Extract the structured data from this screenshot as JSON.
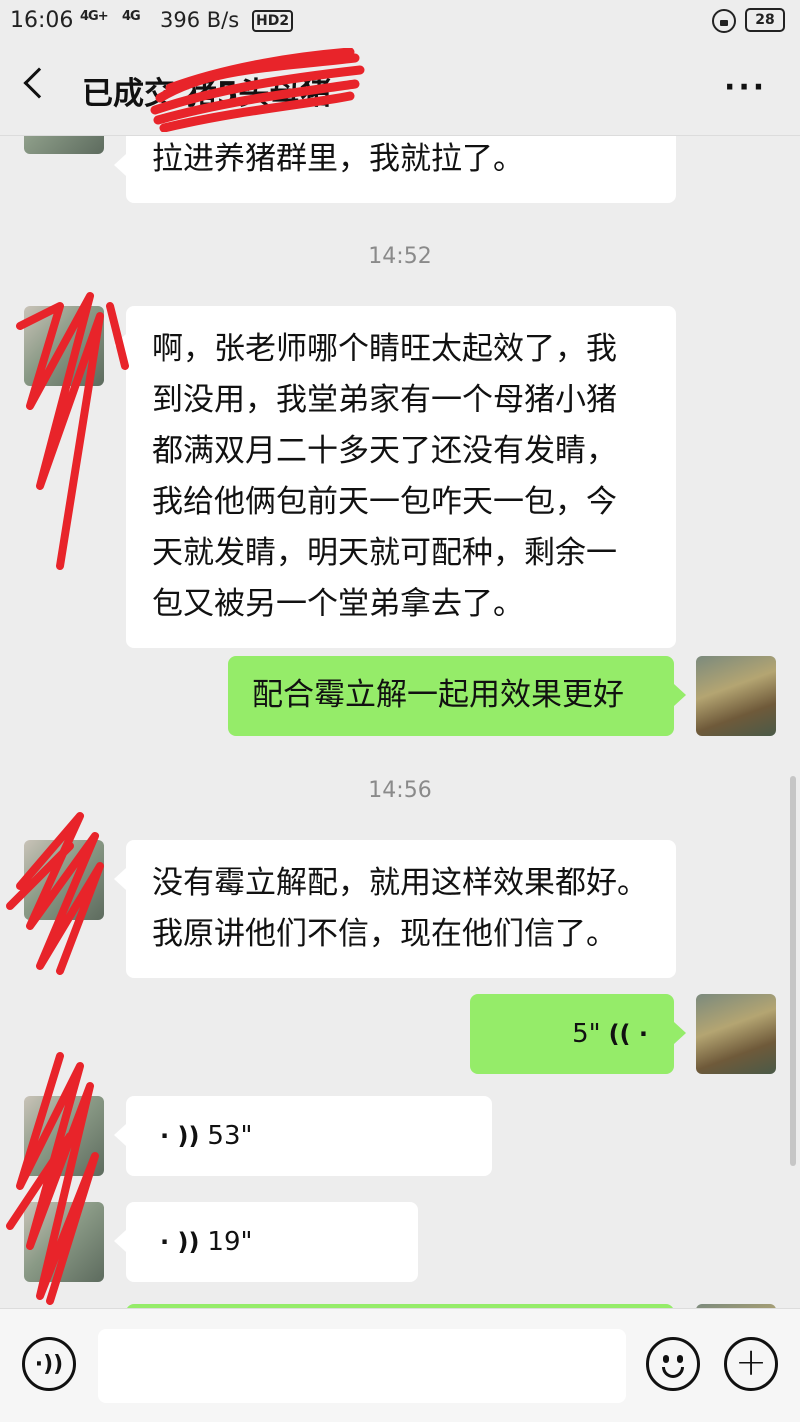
{
  "status_bar": {
    "time": "16:06",
    "signal1": "4G+",
    "signal2": "4G",
    "net_speed": "396 B/s",
    "hd": "HD2",
    "battery": "28"
  },
  "header": {
    "title": "已成交          猪5头母猪",
    "more": "···"
  },
  "messages": [
    {
      "side": "left",
      "text": "拉进养猪群里，我就拉了。"
    },
    {
      "type": "time",
      "text": "14:52"
    },
    {
      "side": "left",
      "lines": [
        "啊，张老师哪个睛旺太起效了，我",
        "到没用，我堂弟家有一个母猪小猪",
        "都满双月二十多天了还没有发睛，",
        "我给他俩包前天一包咋天一包，今",
        "天就发睛，明天就可配种，剩余一",
        "包又被另一个堂弟拿去了。"
      ]
    },
    {
      "side": "right",
      "text": "配合霉立解一起用效果更好"
    },
    {
      "type": "time",
      "text": "14:56"
    },
    {
      "side": "left",
      "lines": [
        "没有霉立解配，就用这样效果都好。",
        "我原讲他们不信，现在他们信了。"
      ]
    },
    {
      "side": "right",
      "type": "voice",
      "duration": "5\""
    },
    {
      "side": "left",
      "type": "voice",
      "duration": "53\""
    },
    {
      "side": "left",
      "type": "voice",
      "duration": "19\""
    }
  ],
  "input_bar": {
    "placeholder": ""
  },
  "colors": {
    "background": "#ededed",
    "sent_bubble": "#95ec69",
    "received_bubble": "#ffffff",
    "redaction": "#e8242a"
  },
  "icons": [
    "back-arrow-icon",
    "more-icon",
    "voice-input-icon",
    "emoji-icon",
    "plus-icon",
    "voice-wave-icon",
    "lock-icon",
    "battery-icon"
  ]
}
